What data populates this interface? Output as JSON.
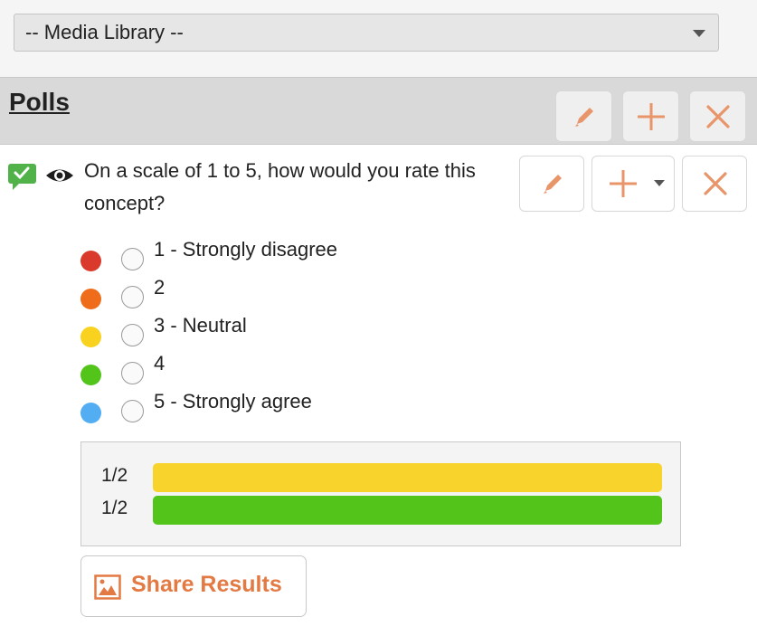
{
  "media_library": {
    "selected": "-- Media Library --"
  },
  "polls": {
    "title": "Polls"
  },
  "question": {
    "text": "On a scale of 1 to 5, how would you rate this concept?"
  },
  "options": [
    {
      "label": "1 - Strongly disagree",
      "color": "#d93a2b"
    },
    {
      "label": "2",
      "color": "#ee6c1a"
    },
    {
      "label": "3 - Neutral",
      "color": "#f8d21e"
    },
    {
      "label": "4",
      "color": "#52c41a"
    },
    {
      "label": "5 - Strongly agree",
      "color": "#52adf2"
    }
  ],
  "results": [
    {
      "label": "1/2",
      "color": "#f8d32b",
      "fraction": 0.5
    },
    {
      "label": "1/2",
      "color": "#52c41a",
      "fraction": 0.5
    }
  ],
  "share": {
    "label": "Share Results"
  },
  "colors": {
    "accent": "#e8956a",
    "share_text": "#e37a43",
    "header_bg": "#d9d9d9"
  },
  "icons": [
    "pencil-icon",
    "plus-icon",
    "close-icon",
    "chat-check-icon",
    "eye-icon",
    "chevron-down-icon",
    "image-icon"
  ]
}
